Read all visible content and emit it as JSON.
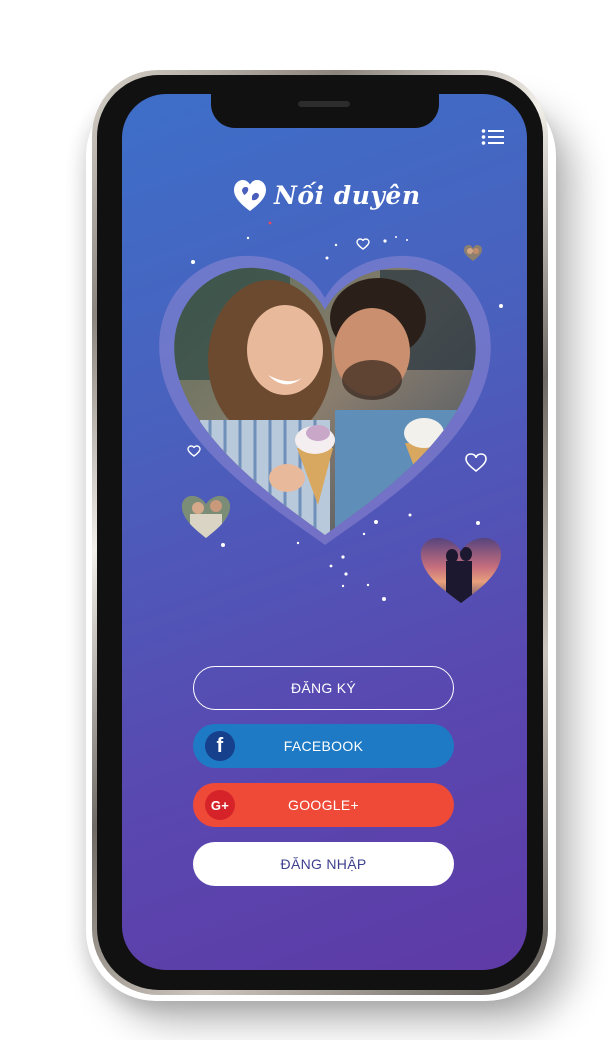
{
  "app": {
    "name": "Nối duyên"
  },
  "buttons": {
    "register": "ĐĂNG KÝ",
    "facebook": "FACEBOOK",
    "google": "GOOGLE+",
    "login": "ĐĂNG NHẬP"
  },
  "icons": {
    "menu": "list-menu-icon",
    "logo": "heart-couple-logo-icon",
    "facebook": "facebook-icon",
    "google": "google-plus-icon",
    "facebook_glyph": "f",
    "google_glyph": "G+"
  },
  "colors": {
    "screen_gradient_start": "#3d6fc9",
    "screen_gradient_end": "#5e3aa6",
    "facebook": "#1e7ac4",
    "google": "#ef4a38",
    "login_text": "#3d3f8e"
  }
}
